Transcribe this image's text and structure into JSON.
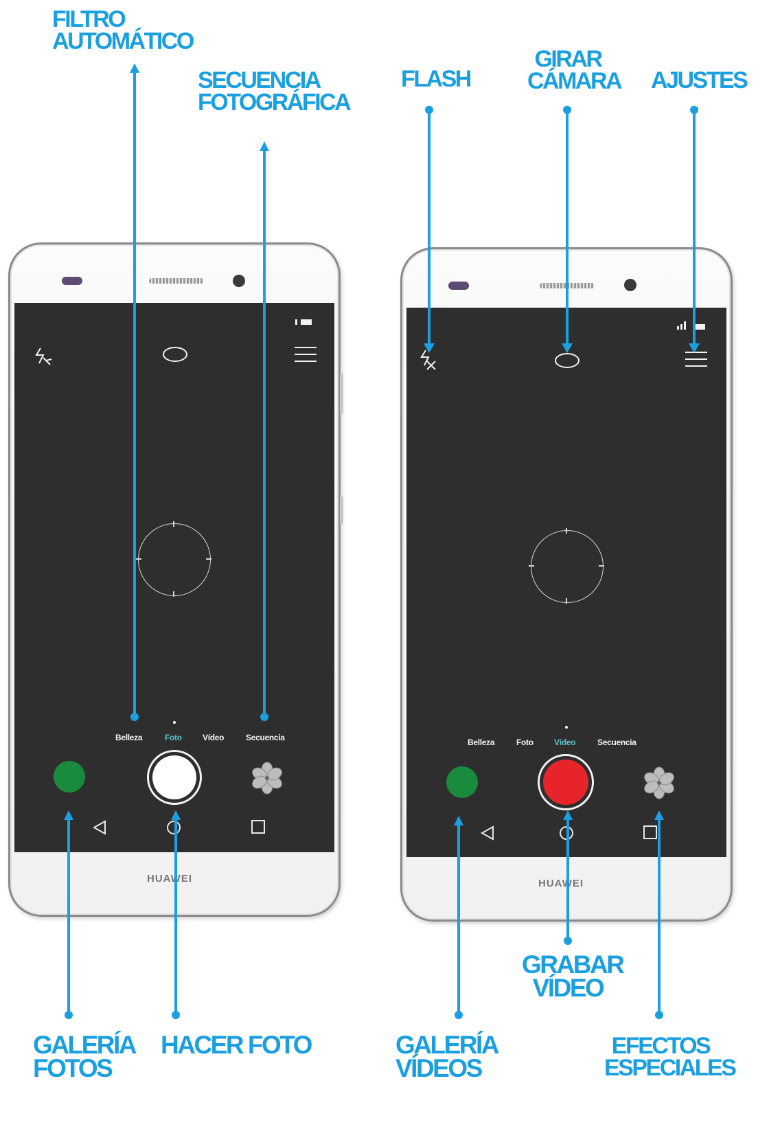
{
  "colors": {
    "callout": "#1a9fe0",
    "screen": "#2f2e2f",
    "gallery": "#1a8a3c",
    "record": "#e8242b",
    "active_mode": "#55c3c7"
  },
  "callouts": {
    "filtro_automatico": [
      "FILTRO",
      "AUTOMÁTICO"
    ],
    "secuencia_fotografica": [
      "SECUENCIA",
      "FOTOGRÁFICA"
    ],
    "flash": [
      "FLASH"
    ],
    "girar_camara": [
      "GIRAR",
      "CÁMARA"
    ],
    "ajustes": [
      "AJUSTES"
    ],
    "galeria_fotos": [
      "GALERÍA",
      "FOTOS"
    ],
    "hacer_foto": [
      "HACER FOTO"
    ],
    "galeria_videos": [
      "GALERÍA",
      "VÍDEOS"
    ],
    "grabar_video": [
      "GRABAR",
      "VÍDEO"
    ],
    "efectos_especiales": [
      "EFECTOS",
      "ESPECIALES"
    ]
  },
  "phone_left": {
    "brand": "HUAWEI",
    "modes": [
      "Belleza",
      "Foto",
      "Vídeo",
      "Secuencia"
    ],
    "active_mode": "Foto",
    "icons": [
      "flash-icon",
      "rotate-camera-icon",
      "menu-icon",
      "battery-icon",
      "gallery-icon",
      "shutter-photo-icon",
      "effects-flower-icon",
      "back-icon",
      "home-icon",
      "recents-icon"
    ]
  },
  "phone_right": {
    "brand": "HUAWEI",
    "modes": [
      "Belleza",
      "Foto",
      "Vídeo",
      "Secuencia"
    ],
    "active_mode": "Vídeo",
    "icons": [
      "flash-off-icon",
      "rotate-camera-icon",
      "menu-icon",
      "signal-icon",
      "battery-icon",
      "gallery-icon",
      "record-video-icon",
      "effects-flower-icon",
      "back-icon",
      "home-icon",
      "recents-icon"
    ]
  }
}
